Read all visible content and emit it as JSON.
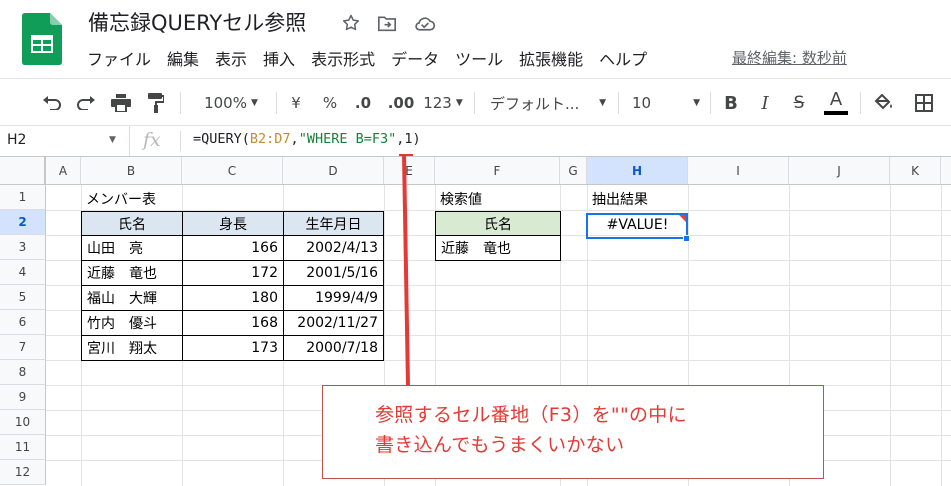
{
  "app": {
    "doc_title": "備忘録QUERYセル参照",
    "last_edit": "最終編集: 数秒前"
  },
  "menu": [
    "ファイル",
    "編集",
    "表示",
    "挿入",
    "表示形式",
    "データ",
    "ツール",
    "拡張機能",
    "ヘルプ"
  ],
  "toolbar": {
    "zoom": "100%",
    "currency": "¥",
    "percent": "%",
    "dec_decrease": ".0",
    "dec_increase": ".00",
    "number_format": "123",
    "font": "デフォルト...",
    "font_size": "10",
    "bold": "B",
    "italic": "I",
    "strike": "S",
    "text_color": "A"
  },
  "formula_bar": {
    "cell_ref": "H2",
    "fx": "fx",
    "formula_prefix": "=QUERY(",
    "formula_range": "B2:D7",
    "formula_sep": ",",
    "formula_string": "\"WHERE B=F3\"",
    "formula_suffix": ",1)"
  },
  "grid": {
    "columns": [
      "A",
      "B",
      "C",
      "D",
      "E",
      "F",
      "G",
      "H",
      "I",
      "J",
      "K"
    ],
    "rows": [
      "1",
      "2",
      "3",
      "4",
      "5",
      "6",
      "7",
      "8",
      "9",
      "10",
      "11",
      "12"
    ],
    "selected_column": "H",
    "selected_row": "2"
  },
  "cells": {
    "B1": "メンバー表",
    "table_headers": [
      "氏名",
      "身長",
      "生年月日"
    ],
    "members": [
      {
        "name": "山田　亮",
        "height": "166",
        "birth": "2002/4/13"
      },
      {
        "name": "近藤　竜也",
        "height": "172",
        "birth": "2001/5/16"
      },
      {
        "name": "福山　大輝",
        "height": "180",
        "birth": "1999/4/9"
      },
      {
        "name": "竹内　優斗",
        "height": "168",
        "birth": "2002/11/27"
      },
      {
        "name": "宮川　翔太",
        "height": "173",
        "birth": "2000/7/18"
      }
    ],
    "F1": "検索値",
    "F2": "氏名",
    "F3": "近藤　竜也",
    "H1": "抽出結果",
    "H2": "#VALUE!"
  },
  "annotation": {
    "line1": "参照するセル番地（F3）を\"\"の中に",
    "line2": "書き込んでもうまくいかない",
    "color": "#e53935"
  },
  "colors": {
    "header_fill": "#dbe6f1",
    "search_fill": "#d9ead3",
    "selection": "#1a73e8",
    "sheets_green": "#0f9d58"
  }
}
